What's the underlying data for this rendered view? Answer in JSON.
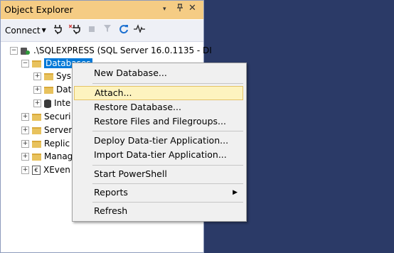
{
  "panel": {
    "title": "Object Explorer",
    "icons": {
      "dropdown": "▾",
      "pin": "ᗘ",
      "close": "✕"
    }
  },
  "toolbar": {
    "connect_label": "Connect",
    "tool_icons": [
      "plug-icon",
      "disconnect-icon",
      "stop-icon",
      "filter-icon",
      "refresh-icon",
      "activity-monitor-icon"
    ]
  },
  "tree": {
    "server": ".\\SQLEXPRESS (SQL Server 16.0.1135 - DI",
    "databases": "Databases",
    "children": [
      "Sys",
      "Dat",
      "Inte"
    ],
    "top_nodes": [
      "Securi",
      "Server",
      "Replic",
      "Manag",
      "XEven"
    ]
  },
  "context_menu": {
    "items": {
      "new_database": "New Database...",
      "attach": "Attach...",
      "restore_database": "Restore Database...",
      "restore_files": "Restore Files and Filegroups...",
      "deploy_dac": "Deploy Data-tier Application...",
      "import_dac": "Import Data-tier Application...",
      "start_powershell": "Start PowerShell",
      "reports": "Reports",
      "refresh": "Refresh"
    },
    "highlighted": "Attach..."
  },
  "colors": {
    "title_bar": "#f5cc84",
    "right_background": "#2b3a67",
    "selection": "#0078d7",
    "menu_hover": "#fdf3bf"
  }
}
